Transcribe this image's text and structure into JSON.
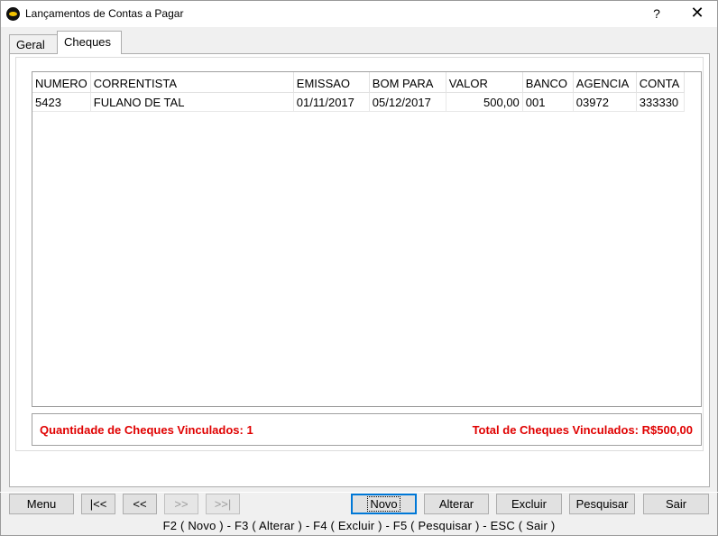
{
  "window": {
    "title": "Lançamentos de Contas a Pagar",
    "help_label": "?",
    "close_label": "✕"
  },
  "tabs": [
    {
      "label": "Geral",
      "active": false
    },
    {
      "label": "Cheques",
      "active": true
    }
  ],
  "grid": {
    "columns": [
      "NUMERO",
      "CORRENTISTA",
      "EMISSAO",
      "BOM PARA",
      "VALOR",
      "BANCO",
      "AGENCIA",
      "CONTA"
    ],
    "rows": [
      [
        "5423",
        "FULANO DE TAL",
        "01/11/2017",
        "05/12/2017",
        "500,00",
        "001",
        "03972",
        "333330"
      ]
    ]
  },
  "summary": {
    "quantity": "Quantidade de Cheques Vinculados: 1",
    "total": "Total de Cheques Vinculados: R$500,00",
    "color": "#e00000"
  },
  "buttons": {
    "menu": "Menu",
    "first": "|<<",
    "prev": "<<",
    "next": ">>",
    "last": ">>|",
    "novo": "Novo",
    "alterar": "Alterar",
    "excluir": "Excluir",
    "pesquisar": "Pesquisar",
    "sair": "Sair"
  },
  "shortcuts": "F2 ( Novo )  -  F3 ( Alterar )  -  F4 ( Excluir )  -  F5 ( Pesquisar )  -  ESC ( Sair )"
}
